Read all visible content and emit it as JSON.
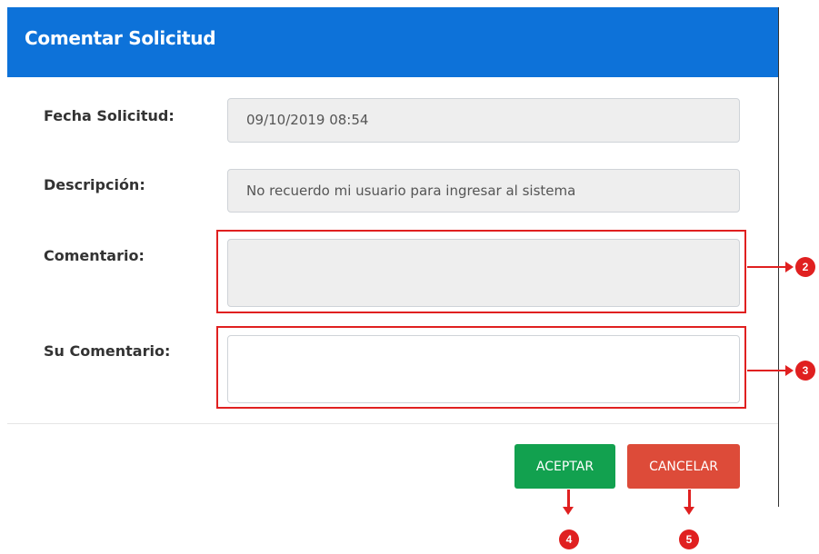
{
  "modal": {
    "title": "Comentar Solicitud",
    "fields": {
      "fecha": {
        "label": "Fecha Solicitud:",
        "value": "09/10/2019 08:54"
      },
      "descripcion": {
        "label": "Descripción:",
        "value": "No recuerdo mi usuario para ingresar al sistema"
      },
      "comentario": {
        "label": "Comentario:",
        "value": ""
      },
      "su_comentario": {
        "label": "Su Comentario:",
        "value": ""
      }
    },
    "buttons": {
      "accept": "ACEPTAR",
      "cancel": "CANCELAR"
    }
  },
  "annotations": {
    "markers": [
      "2",
      "3",
      "4",
      "5"
    ],
    "color": "#e02020"
  },
  "colors": {
    "header": "#0d72d9",
    "accept": "#12a14f",
    "cancel": "#dd4b39"
  }
}
